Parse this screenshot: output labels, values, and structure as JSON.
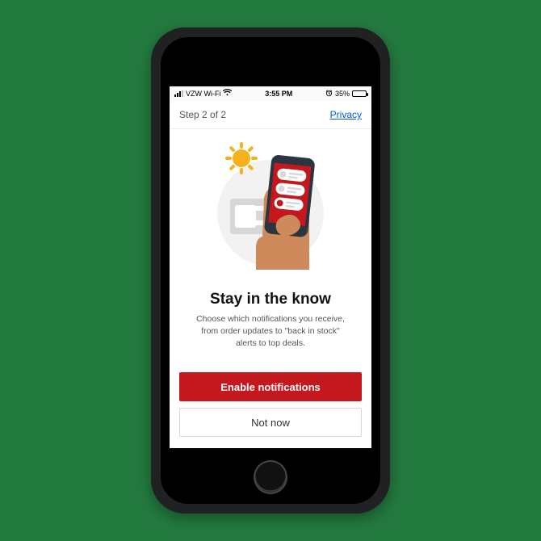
{
  "status_bar": {
    "carrier": "VZW Wi-Fi",
    "time": "3:55 PM",
    "battery_pct": "35%"
  },
  "header": {
    "step_label": "Step 2 of 2",
    "privacy_label": "Privacy"
  },
  "content": {
    "title": "Stay in the know",
    "subtitle": "Choose which notifications you receive, from order updates to \"back in stock\" alerts to top deals."
  },
  "buttons": {
    "primary_label": "Enable notifications",
    "secondary_label": "Not now"
  },
  "colors": {
    "brand_red": "#c4181f",
    "link_blue": "#0057e5",
    "page_bg": "#237a3f"
  }
}
